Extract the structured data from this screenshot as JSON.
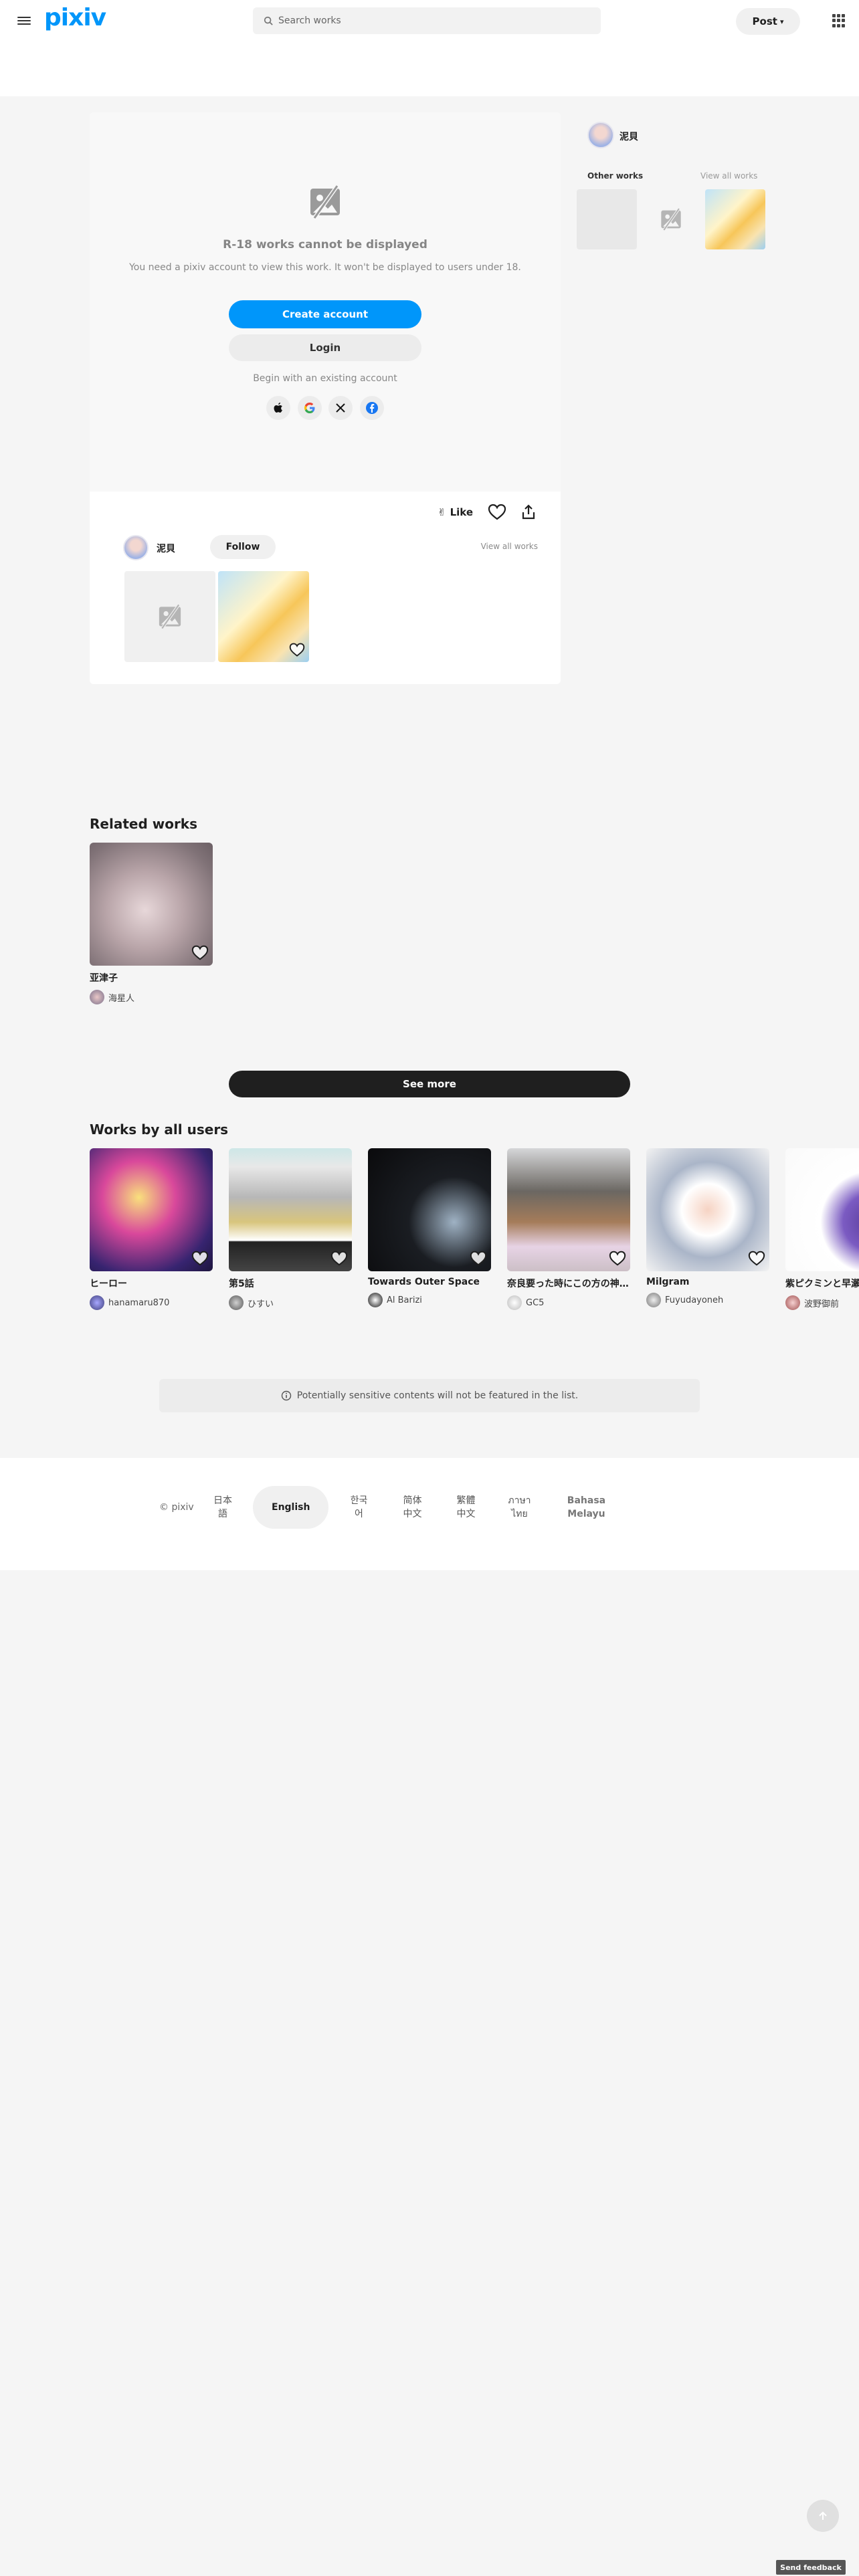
{
  "header": {
    "logo": "pixiv",
    "search_placeholder": "Search works",
    "post_label": "Post"
  },
  "restricted": {
    "title": "R-18 works cannot be displayed",
    "subtitle": "You need a pixiv account to view this work. It won't be displayed to users under 18.",
    "create_account": "Create account",
    "login": "Login",
    "begin_text": "Begin with an existing account",
    "social": [
      "apple-icon",
      "google-icon",
      "x-icon",
      "facebook-icon"
    ]
  },
  "actions": {
    "like_label": "Like"
  },
  "author": {
    "name": "泥貝",
    "follow_label": "Follow",
    "view_all": "View all works"
  },
  "sidebar": {
    "name": "泥貝",
    "other_works": "Other works",
    "view_all": "View all works"
  },
  "related": {
    "title": "Related works",
    "items": [
      {
        "title": "亚津子",
        "user": "海星人"
      }
    ],
    "see_more": "See more"
  },
  "works_by_all": {
    "title": "Works by all users",
    "items": [
      {
        "title": "ヒーロー",
        "user": "hanamaru870"
      },
      {
        "title": "第5話",
        "user": "ひすい"
      },
      {
        "title": "Towards Outer Space",
        "user": "Al Barizi"
      },
      {
        "title": "奈良要った時にこの方の神…",
        "user": "GC5"
      },
      {
        "title": "Milgram",
        "user": "Fuyudayoneh"
      },
      {
        "title": "紫ピクミンと早瀬",
        "user": "波野御前"
      }
    ]
  },
  "notice": "Potentially sensitive contents will not be featured in the list.",
  "footer": {
    "copyright": "© pixiv",
    "languages": [
      "日本語",
      "English",
      "한국어",
      "简体中文",
      "繁體中文",
      "ภาษาไทย",
      "Bahasa Melayu"
    ]
  },
  "feedback": "Send feedback",
  "colors": {
    "accent": "#0096fa",
    "dark_button": "#1f1f1f"
  }
}
